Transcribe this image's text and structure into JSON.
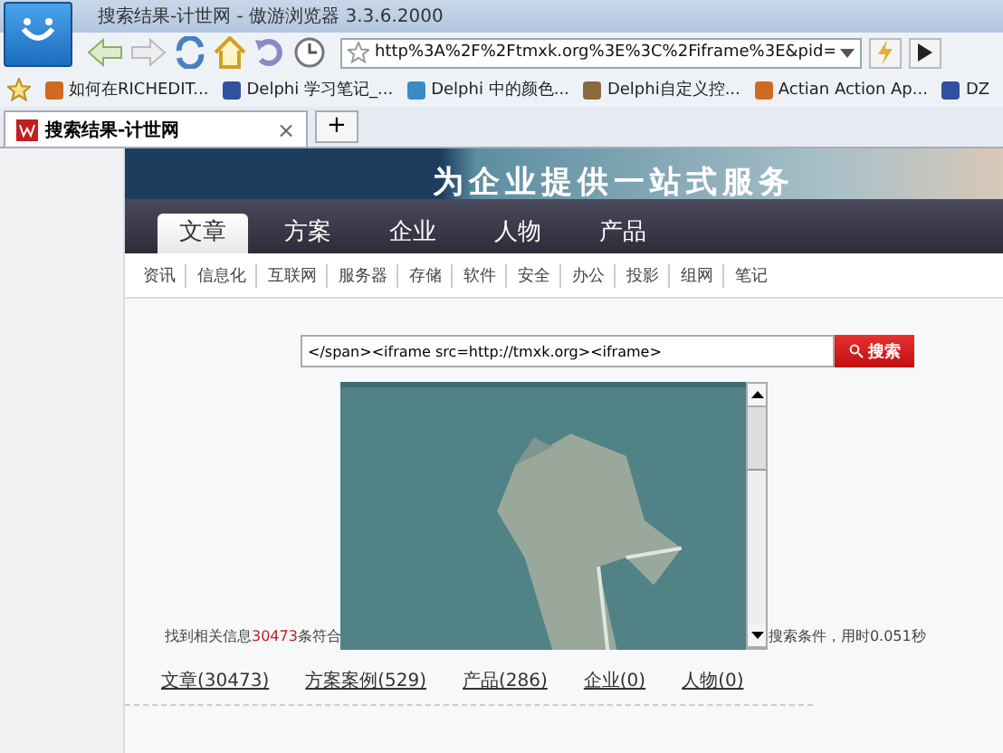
{
  "window": {
    "title": "搜索结果-计世网 - 傲游浏览器 3.3.6.2000"
  },
  "address_bar": {
    "value": "http%3A%2F%2Ftmxk.org%3E%3C%2Fiframe%3E&pid="
  },
  "bookmarks": [
    {
      "label": "如何在RICHEDIT..."
    },
    {
      "label": "Delphi 学习笔记_..."
    },
    {
      "label": "Delphi 中的颜色..."
    },
    {
      "label": "Delphi自定义控..."
    },
    {
      "label": "Actian Action Ap..."
    },
    {
      "label": "DZ"
    }
  ],
  "tabs": [
    {
      "label": "搜索结果-计世网",
      "close": "×",
      "selected": true
    }
  ],
  "new_tab": "+",
  "banner": {
    "slogan": "为企业提供一站式服务"
  },
  "nav": [
    {
      "label": "文章",
      "selected": true
    },
    {
      "label": "方案",
      "selected": false
    },
    {
      "label": "企业",
      "selected": false
    },
    {
      "label": "人物",
      "selected": false
    },
    {
      "label": "产品",
      "selected": false
    }
  ],
  "subnav": [
    "资讯",
    "信息化",
    "互联网",
    "服务器",
    "存储",
    "软件",
    "安全",
    "办公",
    "投影",
    "组网",
    "笔记"
  ],
  "search": {
    "value": "</span><iframe src=http://tmxk.org><iframe>",
    "button": "搜索"
  },
  "result_summary": {
    "before": "找到相关信息",
    "count": "30473",
    "middle": "条符合",
    "after": "搜索条件，用时0.051秒"
  },
  "categories": [
    "文章(30473)",
    "方案案例(529)",
    "产品(286)",
    "企业(0)",
    "人物(0)"
  ]
}
